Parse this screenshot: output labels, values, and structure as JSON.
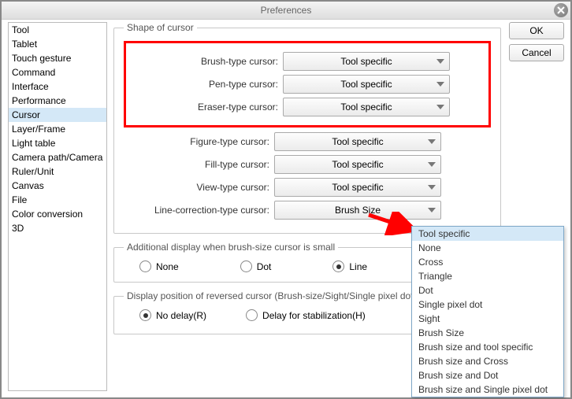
{
  "title": "Preferences",
  "buttons": {
    "ok": "OK",
    "cancel": "Cancel"
  },
  "sidebar": {
    "items": [
      "Tool",
      "Tablet",
      "Touch gesture",
      "Command",
      "Interface",
      "Performance",
      "Cursor",
      "Layer/Frame",
      "Light table",
      "Camera path/Camera",
      "Ruler/Unit",
      "Canvas",
      "File",
      "Color conversion",
      "3D"
    ],
    "selected_index": 6
  },
  "shape_of_cursor": {
    "legend": "Shape of cursor",
    "rows": [
      {
        "label": "Brush-type cursor:",
        "value": "Tool specific"
      },
      {
        "label": "Pen-type cursor:",
        "value": "Tool specific"
      },
      {
        "label": "Eraser-type cursor:",
        "value": "Tool specific"
      },
      {
        "label": "Figure-type cursor:",
        "value": "Tool specific"
      },
      {
        "label": "Fill-type cursor:",
        "value": "Tool specific"
      },
      {
        "label": "View-type cursor:",
        "value": "Tool specific"
      },
      {
        "label": "Line-correction-type cursor:",
        "value": "Brush Size"
      }
    ]
  },
  "additional_display": {
    "legend": "Additional display when brush-size cursor is small",
    "options": [
      "None",
      "Dot",
      "Line"
    ],
    "selected_index": 2
  },
  "display_position": {
    "legend": "Display position of reversed cursor (Brush-size/Sight/Single pixel dot)",
    "options": [
      "No delay(R)",
      "Delay for stabilization(H)"
    ],
    "selected_index": 0
  },
  "dropdown_menu": {
    "items": [
      "Tool specific",
      "None",
      "Cross",
      "Triangle",
      "Dot",
      "Single pixel dot",
      "Sight",
      "Brush Size",
      "Brush size and tool specific",
      "Brush size and Cross",
      "Brush size and Dot",
      "Brush size and Single pixel dot"
    ],
    "selected_index": 0
  }
}
